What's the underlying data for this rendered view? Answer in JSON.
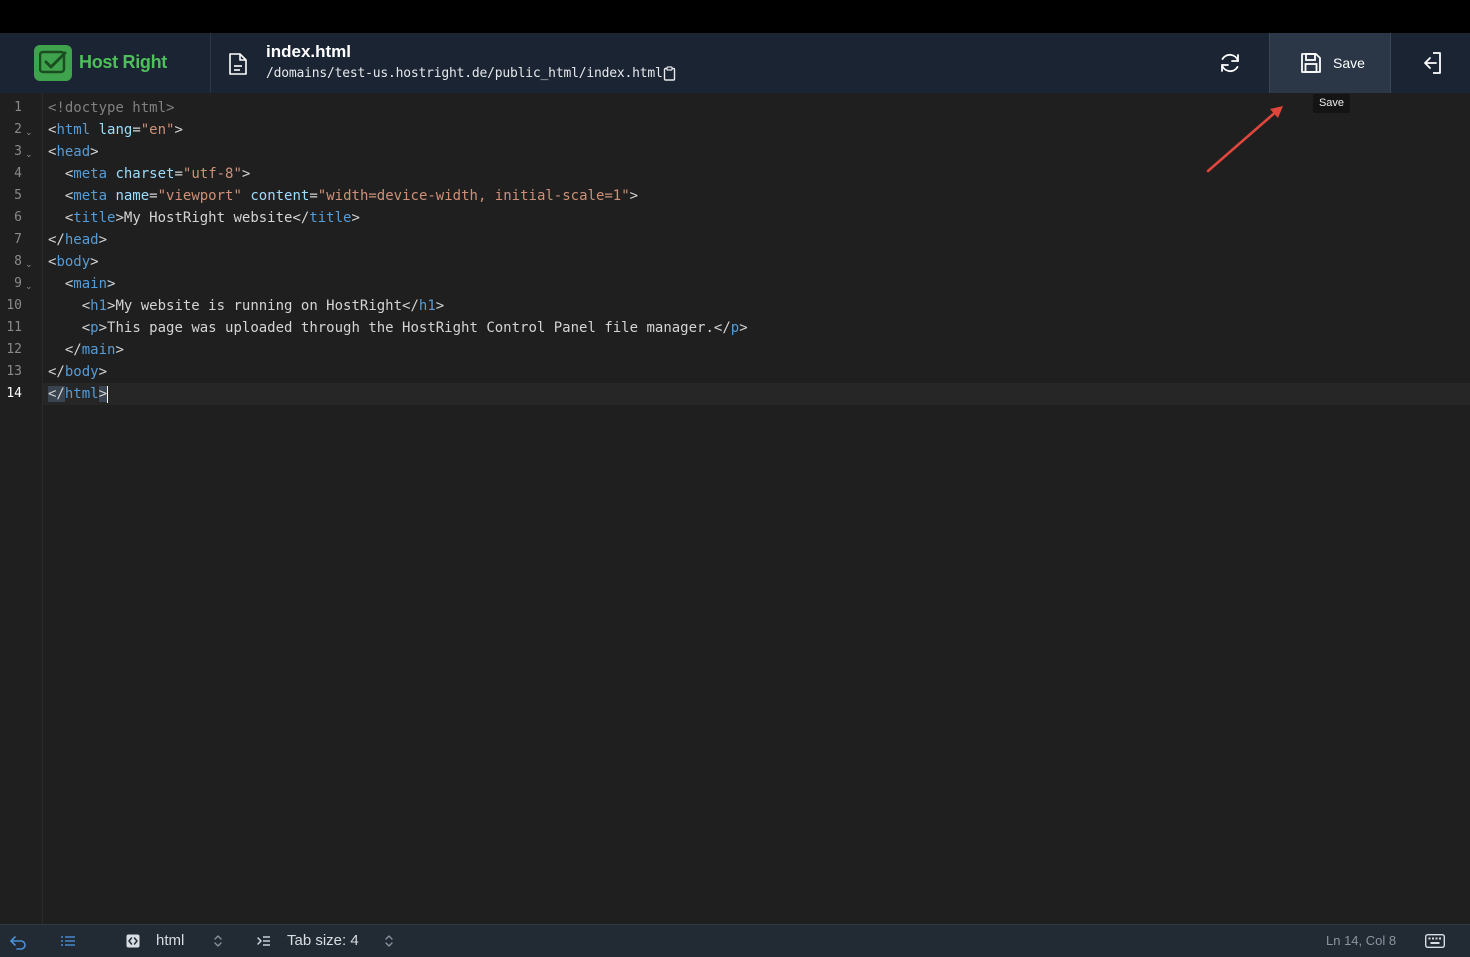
{
  "brand": {
    "name": "Host Right",
    "color": "#4fbf5c"
  },
  "file": {
    "name": "index.html",
    "path": "/domains/test-us.hostright.de/public_html/index.html"
  },
  "toolbar": {
    "refresh_icon": "refresh-icon",
    "save_label": "Save",
    "save_tooltip": "Save",
    "exit_icon": "exit-icon"
  },
  "editor": {
    "lines": [
      "<!doctype html>",
      "<html lang=\"en\">",
      "<head>",
      "  <meta charset=\"utf-8\">",
      "  <meta name=\"viewport\" content=\"width=device-width, initial-scale=1\">",
      "  <title>My HostRight website</title>",
      "</head>",
      "<body>",
      "  <main>",
      "    <h1>My website is running on HostRight</h1>",
      "    <p>This page was uploaded through the HostRight Control Panel file manager.</p>",
      "  </main>",
      "</body>",
      "</html>"
    ],
    "line_numbers": [
      "1",
      "2",
      "3",
      "4",
      "5",
      "6",
      "7",
      "8",
      "9",
      "10",
      "11",
      "12",
      "13",
      "14"
    ],
    "foldable_lines": [
      2,
      3,
      8,
      9
    ],
    "active_line": 14
  },
  "status": {
    "language": "html",
    "tab_size": "Tab size: 4",
    "cursor_position": "Ln 14, Col 8"
  }
}
